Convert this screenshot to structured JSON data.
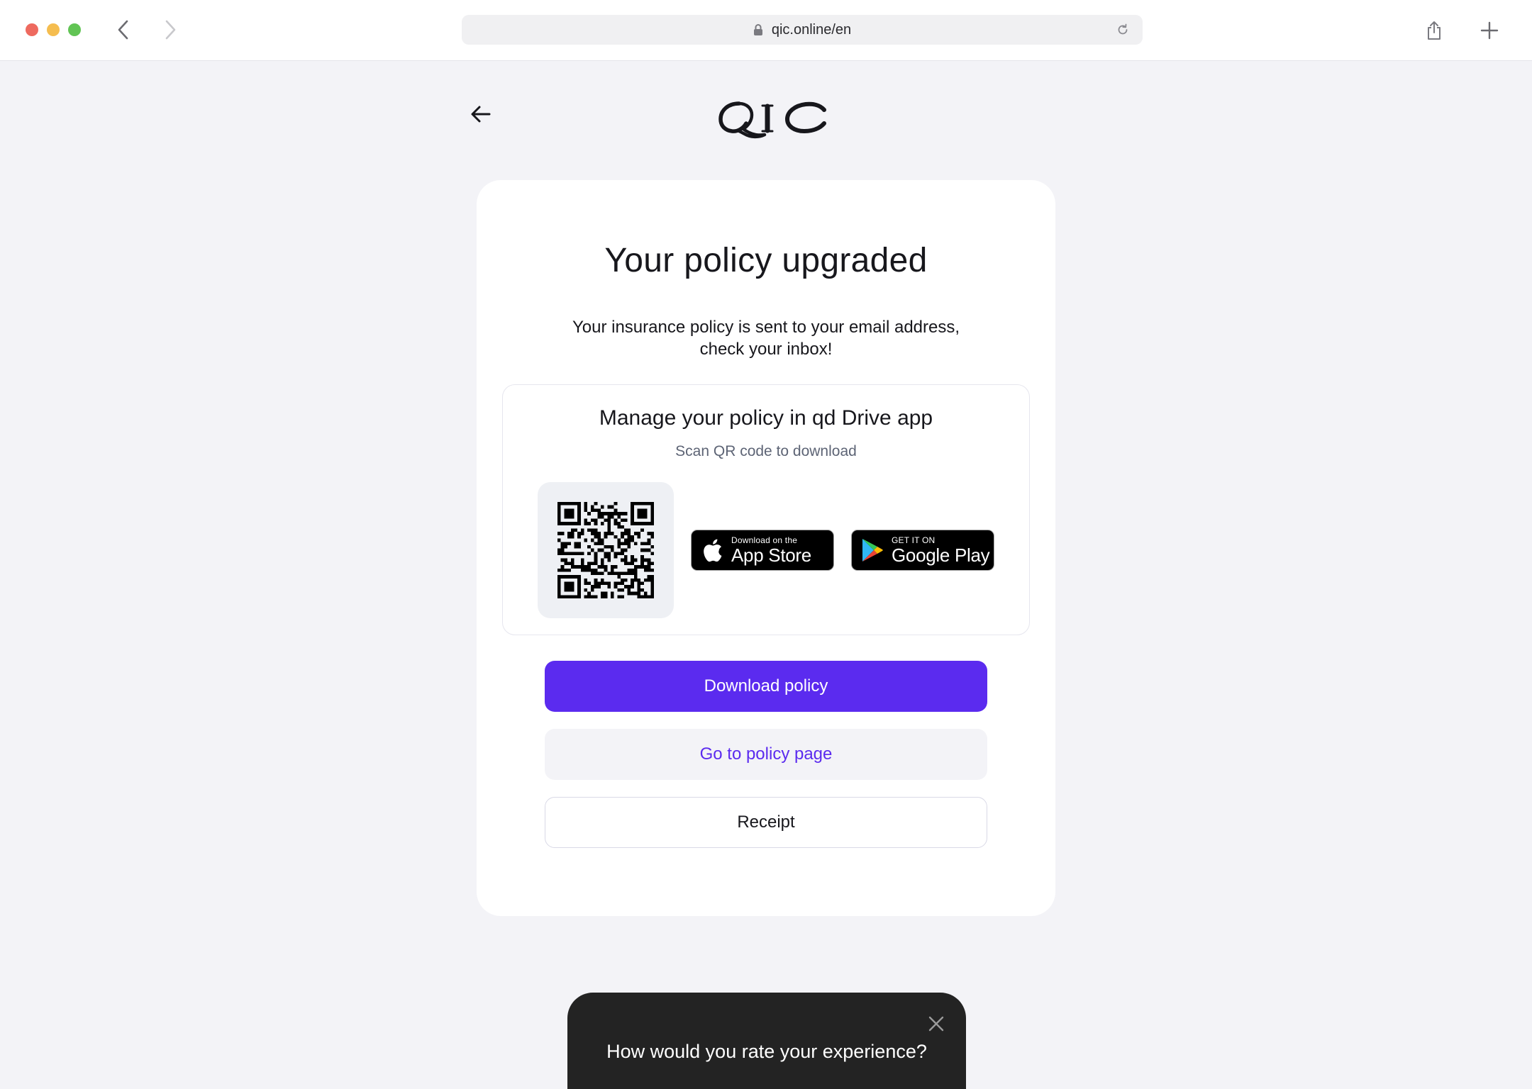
{
  "browser": {
    "url": "qic.online/en"
  },
  "header": {
    "logo_text": "QIC"
  },
  "card": {
    "title": "Your policy upgraded",
    "subtitle_line1": "Your insurance policy is sent to your email address,",
    "subtitle_line2": "check your inbox!"
  },
  "app_promo": {
    "title": "Manage your policy in qd Drive app",
    "subtitle": "Scan QR code to download",
    "app_store": {
      "small": "Download on the",
      "big": "App Store"
    },
    "google_play": {
      "small": "GET IT ON",
      "big": "Google Play"
    }
  },
  "actions": {
    "download": "Download policy",
    "policy_page": "Go to policy page",
    "receipt": "Receipt"
  },
  "rating": {
    "question": "How would you rate your experience?"
  },
  "colors": {
    "accent": "#5b2bef",
    "page_bg": "#f3f3f7",
    "popup_bg": "#232323"
  }
}
